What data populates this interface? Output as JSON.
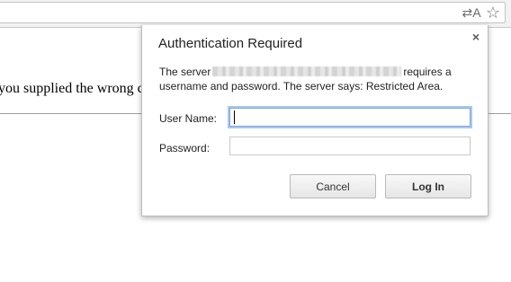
{
  "toolbar": {
    "translate_glyph": "⇄A",
    "star_glyph": "☆",
    "icons": [
      "translate-icon",
      "bookmark-star-icon"
    ]
  },
  "page": {
    "text": "you supplied the wrong cre                                                                           erstan"
  },
  "dialog": {
    "title": "Authentication Required",
    "close_glyph": "×",
    "message_prefix": "The server",
    "message_suffix": "requires a username and password. The server says: Restricted Area.",
    "user_label": "User Name:",
    "user_value": "",
    "pass_label": "Password:",
    "pass_value": "",
    "cancel_label": "Cancel",
    "login_label": "Log In"
  }
}
